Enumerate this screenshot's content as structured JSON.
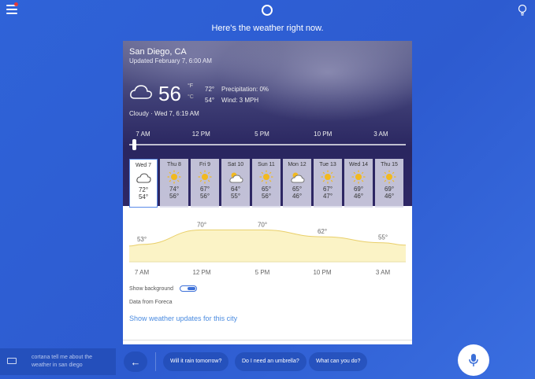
{
  "header": {
    "headline": "Here's the weather right now."
  },
  "weather": {
    "city": "San Diego, CA",
    "updated": "Updated February 7, 6:00 AM",
    "temp": "56",
    "unit_f": "°F",
    "unit_c": "°C",
    "high": "72°",
    "low": "54°",
    "precipitation": "Precipitation: 0%",
    "wind": "Wind: 3 MPH",
    "condition": "Cloudy  ·  Wed 7, 6:19 AM",
    "timeline_labels": [
      "7 AM",
      "12 PM",
      "5 PM",
      "10 PM",
      "3 AM"
    ],
    "days": [
      {
        "name": "Wed 7",
        "icon": "cloud-icon",
        "hi": "72°",
        "lo": "54°"
      },
      {
        "name": "Thu 8",
        "icon": "sun-icon",
        "hi": "74°",
        "lo": "56°"
      },
      {
        "name": "Fri 9",
        "icon": "sun-icon",
        "hi": "67°",
        "lo": "56°"
      },
      {
        "name": "Sat 10",
        "icon": "partly-cloudy-icon",
        "hi": "64°",
        "lo": "55°"
      },
      {
        "name": "Sun 11",
        "icon": "sun-icon",
        "hi": "65°",
        "lo": "56°"
      },
      {
        "name": "Mon 12",
        "icon": "partly-cloudy-icon",
        "hi": "65°",
        "lo": "46°"
      },
      {
        "name": "Tue 13",
        "icon": "sun-icon",
        "hi": "67°",
        "lo": "47°"
      },
      {
        "name": "Wed 14",
        "icon": "sun-icon",
        "hi": "69°",
        "lo": "46°"
      },
      {
        "name": "Thu 15",
        "icon": "sun-icon",
        "hi": "69°",
        "lo": "46°"
      }
    ],
    "show_background_label": "Show background",
    "data_from": "Data from Foreca",
    "updates_link": "Show weather updates for this city"
  },
  "chart_data": {
    "type": "area",
    "x": [
      "7 AM",
      "12 PM",
      "5 PM",
      "10 PM",
      "3 AM"
    ],
    "point_labels": [
      "53°",
      "70°",
      "70°",
      "62°",
      "55°"
    ],
    "values": [
      53,
      70,
      70,
      62,
      55
    ],
    "colors": {
      "fill": "#fbf3c6",
      "stroke": "#e9cf6a"
    }
  },
  "bottom": {
    "speech_text": "cortana tell me about the weather in san diego",
    "suggestions": [
      "Will it rain tomorrow?",
      "Do I need an umbrella?",
      "What can you do?"
    ],
    "back_symbol": "←"
  }
}
